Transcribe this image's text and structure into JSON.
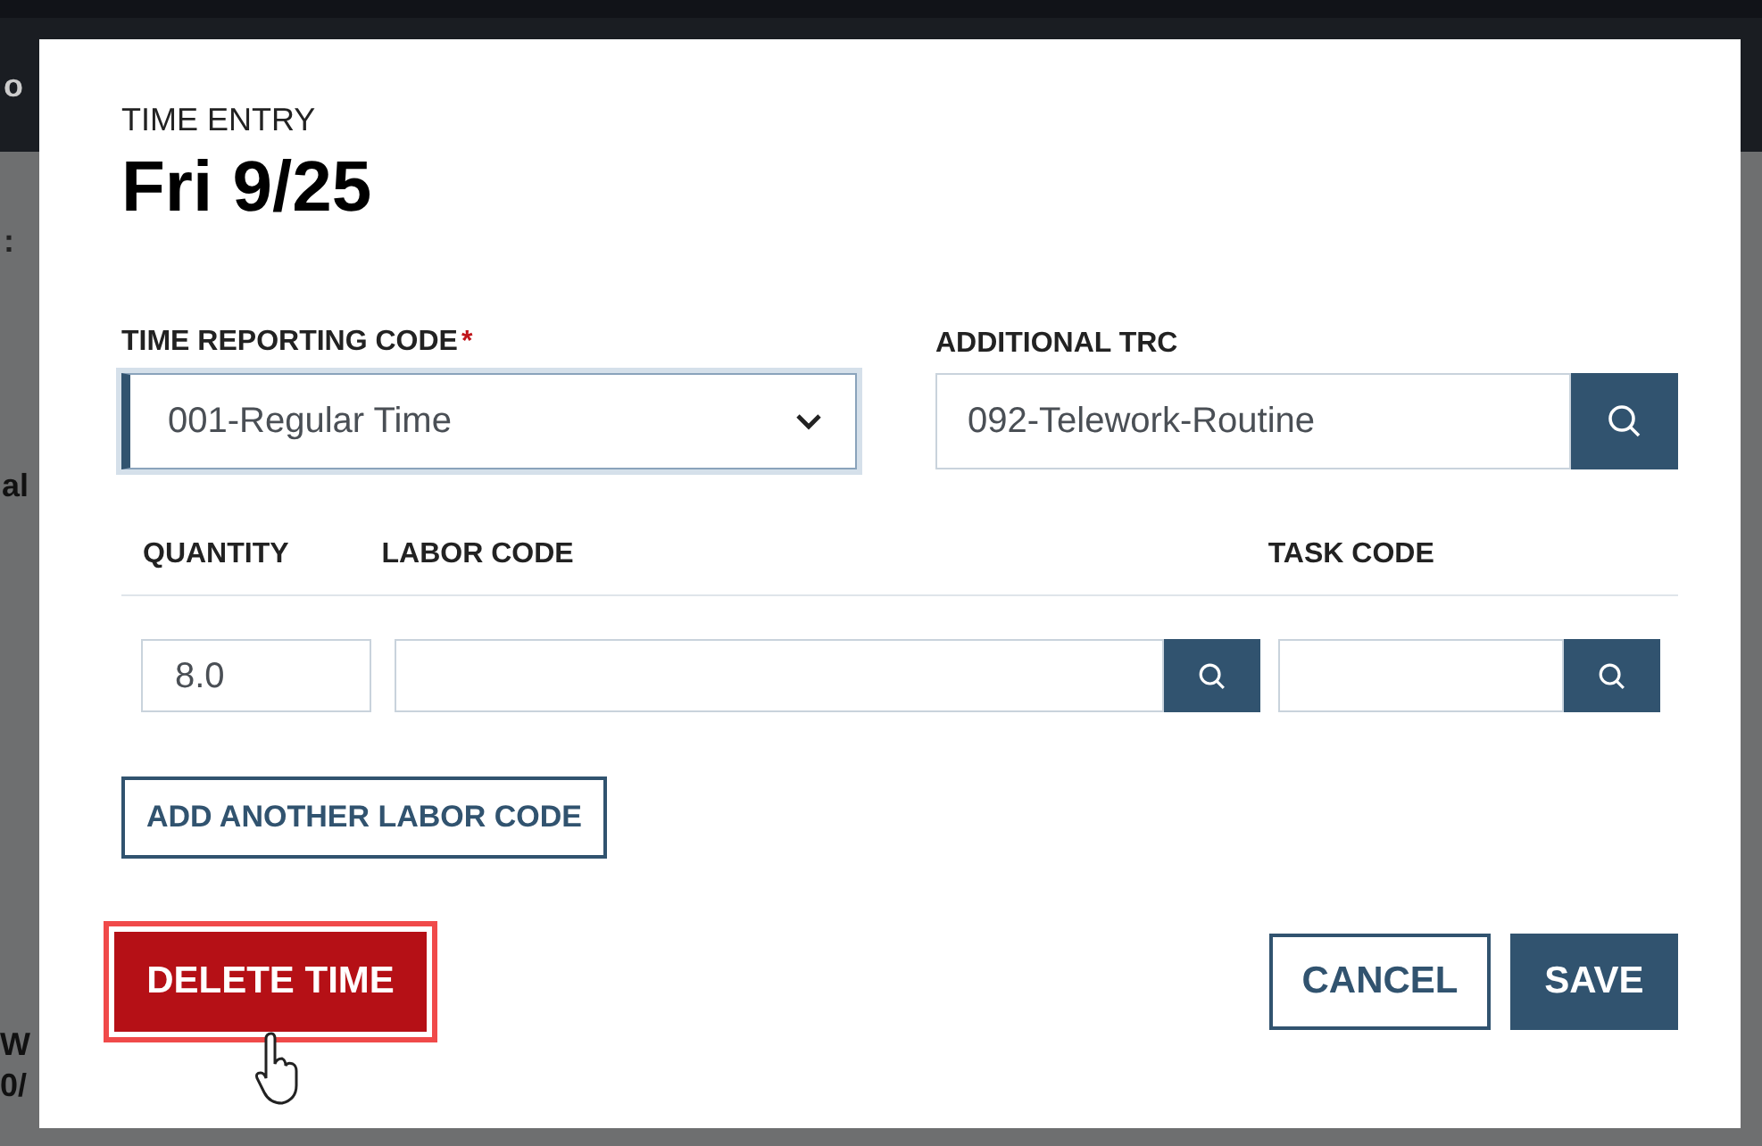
{
  "background_texts": [
    {
      "text": "o"
    },
    {
      "text": ":"
    },
    {
      "text": "al"
    },
    {
      "text": "W"
    },
    {
      "text": "0/"
    }
  ],
  "dialog": {
    "eyebrow": "TIME ENTRY",
    "title": "Fri 9/25",
    "trc": {
      "label": "TIME REPORTING CODE",
      "required_mark": "*",
      "value": "001-Regular Time",
      "focused": true
    },
    "additional_trc": {
      "label": "ADDITIONAL TRC",
      "value": "092-Telework-Routine"
    },
    "columns": [
      "QUANTITY",
      "LABOR CODE",
      "TASK CODE"
    ],
    "row": {
      "quantity": "8.0"
    },
    "add_button": "ADD ANOTHER LABOR CODE",
    "buttons": [
      {
        "label": "DELETE TIME",
        "kind": "danger",
        "focused": true
      },
      {
        "label": "CANCEL",
        "kind": "secondary",
        "focused": false
      },
      {
        "label": "SAVE",
        "kind": "primary",
        "focused": false
      }
    ]
  }
}
